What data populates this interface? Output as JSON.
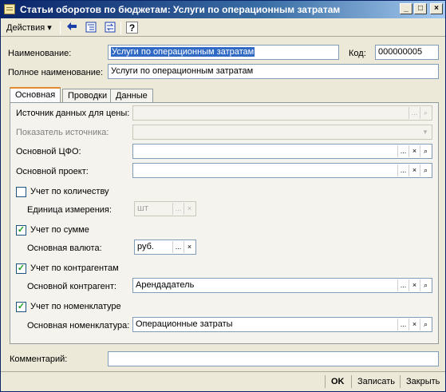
{
  "window": {
    "title": "Статьи оборотов по бюджетам: Услуги по операционным затратам",
    "min_glyph": "_",
    "max_glyph": "□",
    "close_glyph": "×"
  },
  "toolbar": {
    "actions_label": "Действия ▾",
    "help_glyph": "?"
  },
  "form": {
    "name_label": "Наименование:",
    "name_value": "Услуги по операционным затратам",
    "code_label": "Код:",
    "code_value": "000000005",
    "full_name_label": "Полное наименование:",
    "full_name_value": "Услуги по операционным затратам"
  },
  "tabs": [
    {
      "label": "Основная"
    },
    {
      "label": "Проводки"
    },
    {
      "label": "Данные"
    }
  ],
  "main": {
    "price_source_label": "Источник данных для цены:",
    "price_source_value": "",
    "source_indicator_label": "Показатель источника:",
    "source_indicator_value": "",
    "cfo_label": "Основной ЦФО:",
    "cfo_value": "",
    "project_label": "Основной проект:",
    "project_value": "",
    "qty_check_label": "Учет по количеству",
    "qty_checked": false,
    "unit_label": "Единица измерения:",
    "unit_value": "шт",
    "sum_check_label": "Учет по сумме",
    "sum_checked": true,
    "currency_label": "Основная валюта:",
    "currency_value": "руб.",
    "contractor_check_label": "Учет по контрагентам",
    "contractor_checked": true,
    "contractor_label": "Основной контрагент:",
    "contractor_value": "Арендадатель",
    "nomenclature_check_label": "Учет по номенклатуре",
    "nomenclature_checked": true,
    "nomenclature_label": "Основная номенклатура:",
    "nomenclature_value": "Операционные затраты"
  },
  "comment": {
    "label": "Комментарий:",
    "value": ""
  },
  "buttons": {
    "select_glyph": "...",
    "clear_glyph": "×",
    "open_glyph": "⌕",
    "dropdown_glyph": "▾",
    "check_glyph": "✓",
    "ok": "OK",
    "save": "Записать",
    "close": "Закрыть"
  }
}
